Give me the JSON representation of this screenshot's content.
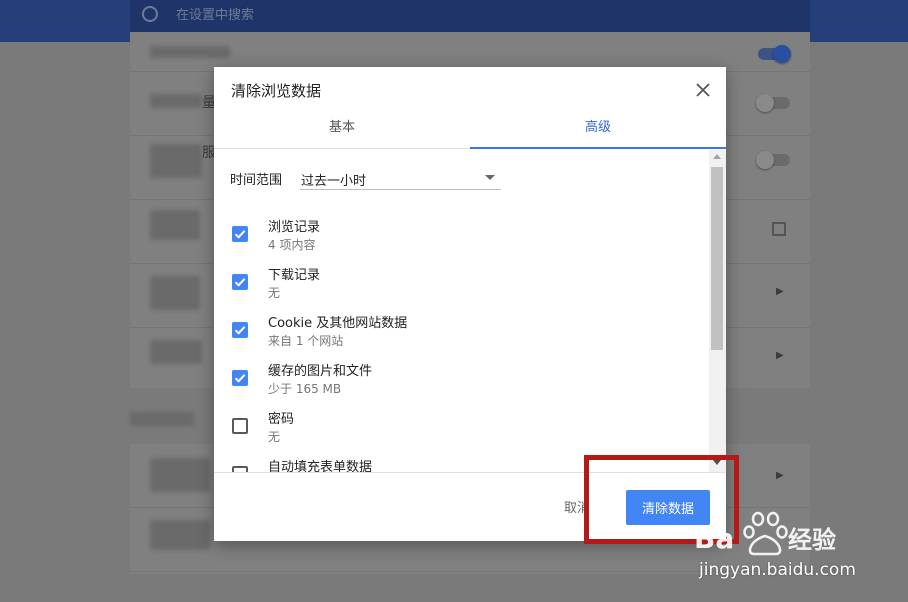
{
  "background": {
    "search_placeholder": "在设置中搜索"
  },
  "dialog": {
    "title": "清除浏览数据",
    "tabs": [
      {
        "label": "基本",
        "active": false
      },
      {
        "label": "高级",
        "active": true
      }
    ],
    "time_range": {
      "label": "时间范围",
      "value": "过去一小时"
    },
    "items": [
      {
        "title": "浏览记录",
        "subtitle": "4 项内容",
        "checked": true
      },
      {
        "title": "下载记录",
        "subtitle": "无",
        "checked": true
      },
      {
        "title": "Cookie 及其他网站数据",
        "subtitle": "来自 1 个网站",
        "checked": true
      },
      {
        "title": "缓存的图片和文件",
        "subtitle": "少于 165 MB",
        "checked": true
      },
      {
        "title": "密码",
        "subtitle": "无",
        "checked": false
      },
      {
        "title": "自动填充表单数据",
        "subtitle": "",
        "checked": false
      }
    ],
    "buttons": {
      "cancel": "取消",
      "confirm": "清除数据"
    }
  },
  "colors": {
    "accent": "#4285f4",
    "tab_active": "#3367d6",
    "highlight": "#b31b1b"
  },
  "watermark": {
    "brand": "Baidu经验",
    "url": "jingyan.baidu.com"
  }
}
